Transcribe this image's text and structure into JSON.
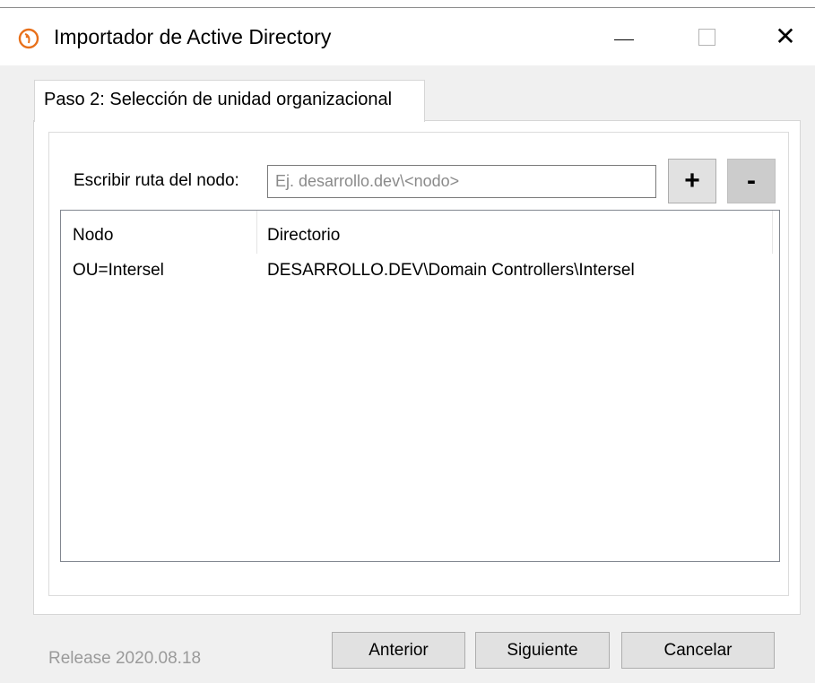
{
  "window": {
    "title": "Importador de Active Directory",
    "controls": {
      "minimize": "minimize-icon",
      "maximize": "maximize-icon",
      "close": "close-icon",
      "close_glyph": "✕"
    }
  },
  "tab": {
    "label": "Paso 2: Selección de unidad organizacional"
  },
  "node_path": {
    "label": "Escribir ruta del nodo:",
    "value": "",
    "placeholder": "Ej. desarrollo.dev\\<nodo>",
    "add_label": "+",
    "remove_label": "-"
  },
  "list": {
    "columns": [
      "Nodo",
      "Directorio"
    ],
    "rows": [
      {
        "nodo": "OU=Intersel",
        "directorio": "DESARROLLO.DEV\\Domain Controllers\\Intersel"
      }
    ]
  },
  "footer": {
    "release": "Release 2020.08.18",
    "prev_label": "Anterior",
    "next_label": "Siguiente",
    "cancel_label": "Cancelar"
  },
  "colors": {
    "accent_icon": "#e8701a",
    "window_bg": "#f0f0f0",
    "button_bg": "#e1e1e1",
    "disabled_text": "#9a9a9a"
  }
}
